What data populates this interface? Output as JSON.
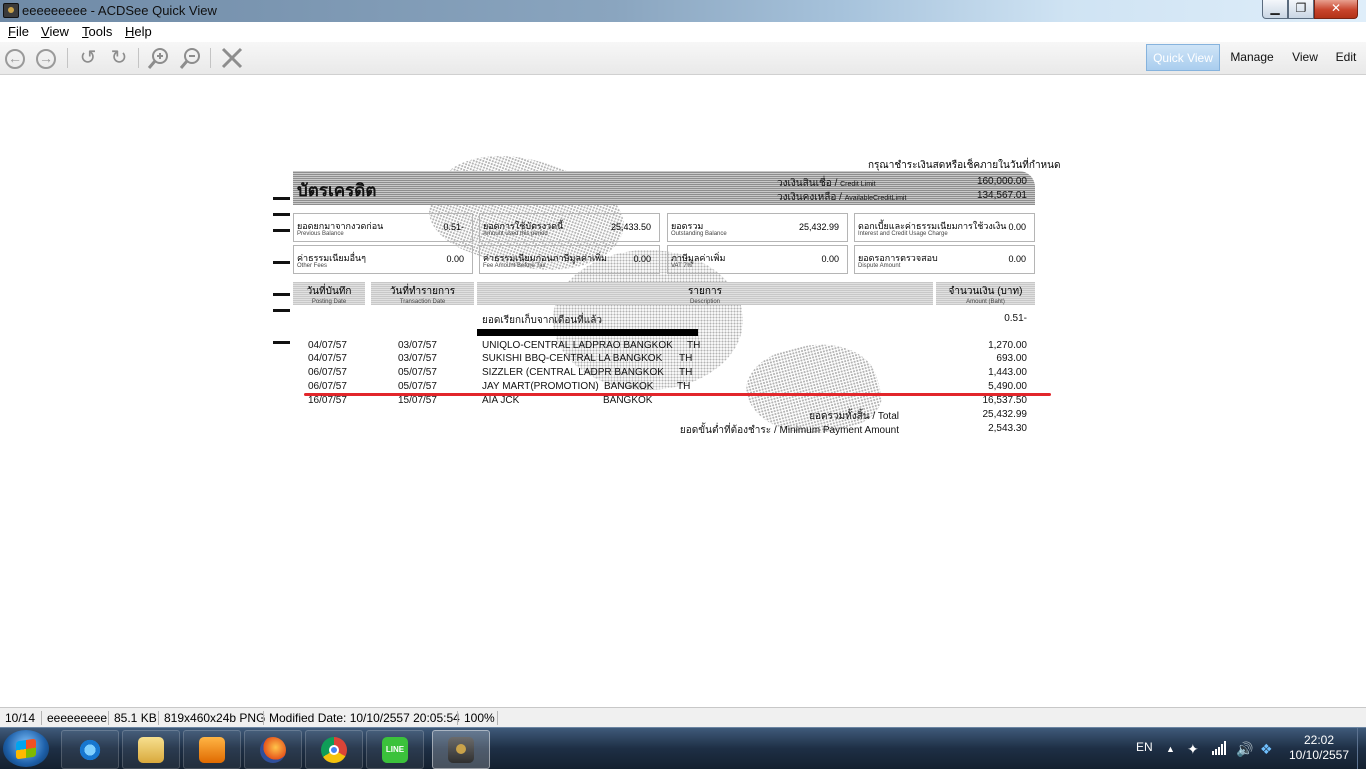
{
  "window": {
    "title": "eeeeeeeee - ACDSee Quick View",
    "controls": {
      "minimize": "▁",
      "maximize": "❐",
      "close": "✕"
    }
  },
  "menu": [
    "File",
    "View",
    "Tools",
    "Help"
  ],
  "menu_mnemonics": [
    "F",
    "V",
    "T",
    "H"
  ],
  "toolbar": {
    "icons": [
      "back-icon",
      "forward-icon",
      "rotate-left-icon",
      "rotate-right-icon",
      "zoom-in-icon",
      "zoom-out-icon",
      "close-icon"
    ],
    "modes": [
      "Quick View",
      "Manage",
      "View",
      "Edit"
    ],
    "active_mode": "Quick View"
  },
  "document": {
    "notice": "กรุณาชำระเงินสดหรือเช็คภายในวันที่กำหนด",
    "title": "บัตรเครดิต",
    "credit_limit_th": "วงเงินสินเชื่อ /",
    "credit_limit_en": "Credit Limit",
    "credit_limit": "160,000.00",
    "available_th": "วงเงินคงเหลือ /",
    "available_en": "AvailableCreditLimit",
    "available": "134,567.01",
    "summary": [
      {
        "th": "ยอดยกมาจากงวดก่อน",
        "en": "Previous Balance",
        "value": "0.51-"
      },
      {
        "th": "ยอดการใช้บัตรงวดนี้",
        "en": "Amount used this period",
        "value": "25,433.50"
      },
      {
        "th": "ยอดรวม",
        "en": "Outstanding Balance",
        "value": "25,432.99"
      },
      {
        "th": "ดอกเบี้ยและค่าธรรมเนียมการใช้วงเงิน",
        "en": "Interest and Credit Usage Charge",
        "value": "0.00"
      },
      {
        "th": "ค่าธรรมเนียมอื่นๆ",
        "en": "Other Fees",
        "value": "0.00"
      },
      {
        "th": "ค่าธรรมเนียมก่อนภาษีมูลค่าเพิ่ม",
        "en": "Fee Amount Before Tax",
        "value": "0.00"
      },
      {
        "th": "ภาษีมูลค่าเพิ่ม",
        "en": "VAT 7%",
        "value": "0.00"
      },
      {
        "th": "ยอดรอการตรวจสอบ",
        "en": "Dispute Amount",
        "value": "0.00"
      }
    ],
    "columns": [
      {
        "th": "วันที่บันทึก",
        "en": "Posting Date"
      },
      {
        "th": "วันที่ทำรายการ",
        "en": "Transaction Date"
      },
      {
        "th": "รายการ",
        "en": "Description"
      },
      {
        "th": "จำนวนเงิน (บาท)",
        "en": "Amount (Baht)"
      }
    ],
    "previous_line": {
      "description": "ยอดเรียกเก็บจากเดือนที่แล้ว",
      "amount": "0.51-"
    },
    "transactions": [
      {
        "posting": "04/07/57",
        "trans": "03/07/57",
        "merchant": "UNIQLO-CENTRAL LADPRAO BANGKOK",
        "city": "",
        "country": "TH",
        "amount": "1,270.00"
      },
      {
        "posting": "04/07/57",
        "trans": "03/07/57",
        "merchant": "SUKISHI BBQ-CENTRAL LA BANGKOK",
        "city": "",
        "country": "TH",
        "amount": "693.00"
      },
      {
        "posting": "06/07/57",
        "trans": "05/07/57",
        "merchant": "SIZZLER (CENTRAL LADPR BANGKOK",
        "city": "",
        "country": "TH",
        "amount": "1,443.00"
      },
      {
        "posting": "06/07/57",
        "trans": "05/07/57",
        "merchant": "JAY MART(PROMOTION)",
        "city": "BANGKOK",
        "country": "TH",
        "amount": "5,490.00"
      },
      {
        "posting": "16/07/57",
        "trans": "15/07/57",
        "merchant": "AIA JCK",
        "city": "BANGKOK",
        "country": "",
        "amount": "16,537.50"
      }
    ],
    "total_label": "ยอดรวมทั้งสิ้น  / Total",
    "total": "25,432.99",
    "min_label": "ยอดขั้นต่ำที่ต้องชำระ / Minimum Payment Amount",
    "min_payment": "2,543.30",
    "annotation_color": "#e2262b"
  },
  "status": {
    "index": "10/14",
    "name": "eeeeeeeee",
    "size": "85.1 KB",
    "info": "819x460x24b PNG",
    "modified": "Modified Date: 10/10/2557 20:05:54",
    "zoom": "100%"
  },
  "taskbar": {
    "apps": [
      "internet-explorer",
      "file-explorer",
      "media-player",
      "firefox",
      "chrome",
      "line",
      "acdsee"
    ],
    "line_label": "LINE",
    "language": "EN",
    "time": "22:02",
    "date": "10/10/2557"
  }
}
